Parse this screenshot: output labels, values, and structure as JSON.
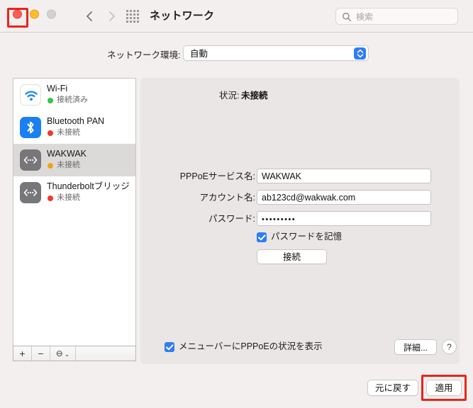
{
  "window": {
    "title": "ネットワーク",
    "traffic_lights": {
      "close_color": "#fc5f57",
      "minimize_color": "#fdbc2c",
      "maximize_color": "#d3d2d2"
    },
    "annotation_color": "#e8251d"
  },
  "toolbar": {
    "back_icon": "chevron-left-icon",
    "forward_icon": "chevron-right-icon",
    "grid_icon": "grid-icon",
    "search": {
      "icon": "search-icon",
      "placeholder": "検索",
      "value": ""
    }
  },
  "location": {
    "label": "ネットワーク環境:",
    "value": "自動",
    "options": [
      "自動"
    ]
  },
  "sidebar": {
    "services": [
      {
        "name": "Wi-Fi",
        "status": "接続済み",
        "status_color": "#34c642",
        "icon": "wifi-icon",
        "selected": false
      },
      {
        "name": "Bluetooth PAN",
        "status": "未接続",
        "status_color": "#f5372b",
        "icon": "bluetooth-icon",
        "selected": false
      },
      {
        "name": "WAKWAK",
        "status": "未接続",
        "status_color": "#f0a21b",
        "icon": "pppoe-icon",
        "selected": true
      },
      {
        "name": "Thunderboltブリッジ",
        "status": "未接続",
        "status_color": "#f5372b",
        "icon": "pppoe-icon",
        "selected": false
      }
    ],
    "toolbar": {
      "add_label": "+",
      "remove_label": "−",
      "action_label": "⊖",
      "action_chevron": "⌄"
    }
  },
  "main": {
    "status_label": "状況:",
    "status_value": "未接続",
    "fields": [
      {
        "label": "PPPoEサービス名:",
        "value": "WAKWAK",
        "type": "text"
      },
      {
        "label": "アカウント名:",
        "value": "ab123cd@wakwak.com",
        "type": "text"
      },
      {
        "label": "パスワード:",
        "value": "•••••••••",
        "type": "password"
      }
    ],
    "remember_password": {
      "label": "パスワードを記憶",
      "checked": true
    },
    "connect_button": "接続",
    "show_status_menubar": {
      "label": "メニューバーにPPPoEの状況を表示",
      "checked": true
    },
    "advanced_button": "詳細...",
    "help_button": "?"
  },
  "footer": {
    "revert_button": "元に戻す",
    "apply_button": "適用"
  }
}
